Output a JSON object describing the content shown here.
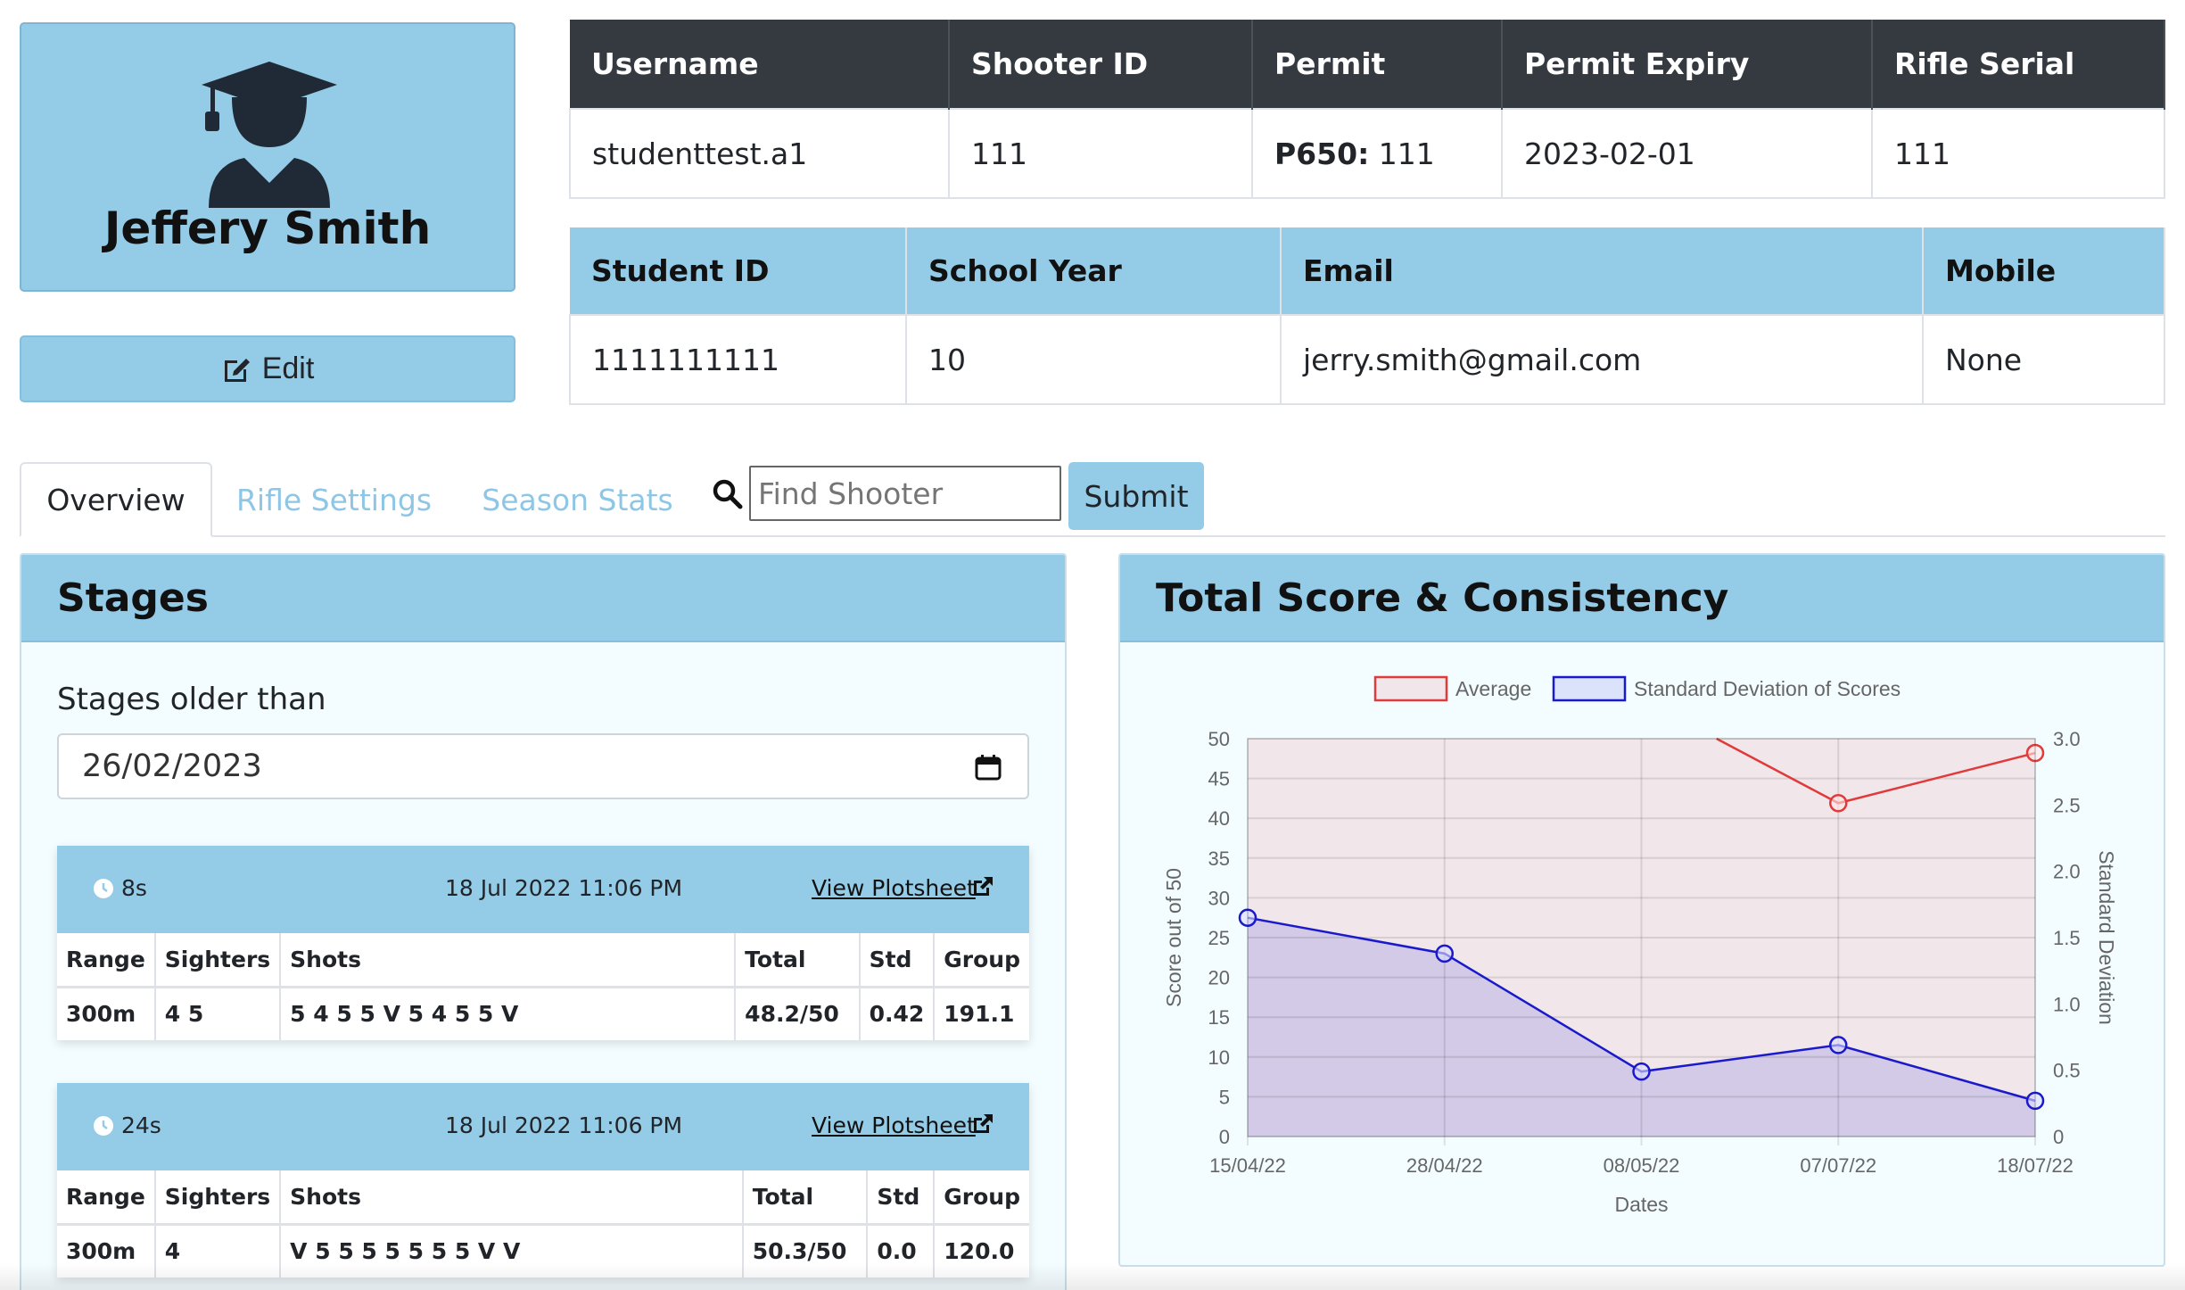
{
  "profile": {
    "name": "Jeffery Smith",
    "edit_label": "Edit"
  },
  "info_table_1": {
    "headers": [
      "Username",
      "Shooter ID",
      "Permit",
      "Permit Expiry",
      "Rifle Serial"
    ],
    "username": "studenttest.a1",
    "shooter_id": "111",
    "permit_label": "P650:",
    "permit_value": "111",
    "permit_expiry": "2023-02-01",
    "rifle_serial": "111"
  },
  "info_table_2": {
    "headers": [
      "Student ID",
      "School Year",
      "Email",
      "Mobile"
    ],
    "student_id": "1111111111",
    "school_year": "10",
    "email": "jerry.smith@gmail.com",
    "mobile": "None"
  },
  "tabs": [
    {
      "label": "Overview",
      "active": true
    },
    {
      "label": "Rifle Settings",
      "active": false
    },
    {
      "label": "Season Stats",
      "active": false
    }
  ],
  "search": {
    "placeholder": "Find Shooter",
    "submit_label": "Submit"
  },
  "stages_panel": {
    "title": "Stages",
    "older_label": "Stages older than",
    "date_value": "26/02/2023",
    "table_headers": [
      "Range",
      "Sighters",
      "Shots",
      "Total",
      "Std",
      "Group"
    ],
    "plotsheet_label": "View Plotsheet",
    "stages": [
      {
        "duration": "8s",
        "datetime": "18 Jul 2022 11:06 PM",
        "row": {
          "range": "300m",
          "sighters": "4 5",
          "shots": "5 4 5 5 V 5 4 5 5 V",
          "total": "48.2/50",
          "std": "0.42",
          "group": "191.1"
        }
      },
      {
        "duration": "24s",
        "datetime": "18 Jul 2022 11:06 PM",
        "row": {
          "range": "300m",
          "sighters": "4",
          "shots": "V 5 5 5 5 5 5 5 V V",
          "total": "50.3/50",
          "std": "0.0",
          "group": "120.0"
        }
      }
    ]
  },
  "chart_panel": {
    "title": "Total Score & Consistency"
  },
  "colors": {
    "accent": "#94cbe7",
    "dark_header": "#343a40",
    "average_line": "#e03a3a",
    "std_line": "#1a1acc"
  },
  "chart_data": {
    "type": "line",
    "categories": [
      "15/04/22",
      "28/04/22",
      "08/05/22",
      "07/07/22",
      "18/07/22"
    ],
    "series": [
      {
        "name": "Average",
        "axis": "left",
        "values": [
          null,
          null,
          null,
          41.9,
          48.2
        ],
        "partial_from_above": 55,
        "fill": true
      },
      {
        "name": "Standard Deviation of Scores",
        "axis": "right",
        "values": [
          1.65,
          1.38,
          0.49,
          0.69,
          0.27
        ],
        "fill": true
      }
    ],
    "xlabel": "Dates",
    "ylabel": "Score out of 50",
    "y2label": "Standard Deviation",
    "ylim": [
      0,
      50
    ],
    "y2lim": [
      0,
      3.0
    ],
    "yticks": [
      "0",
      "5",
      "10",
      "15",
      "20",
      "25",
      "30",
      "35",
      "40",
      "45",
      "50"
    ],
    "y2ticks": [
      "0",
      "0.5",
      "1.0",
      "1.5",
      "2.0",
      "2.5",
      "3.0"
    ],
    "grid": true,
    "legend": "top"
  }
}
